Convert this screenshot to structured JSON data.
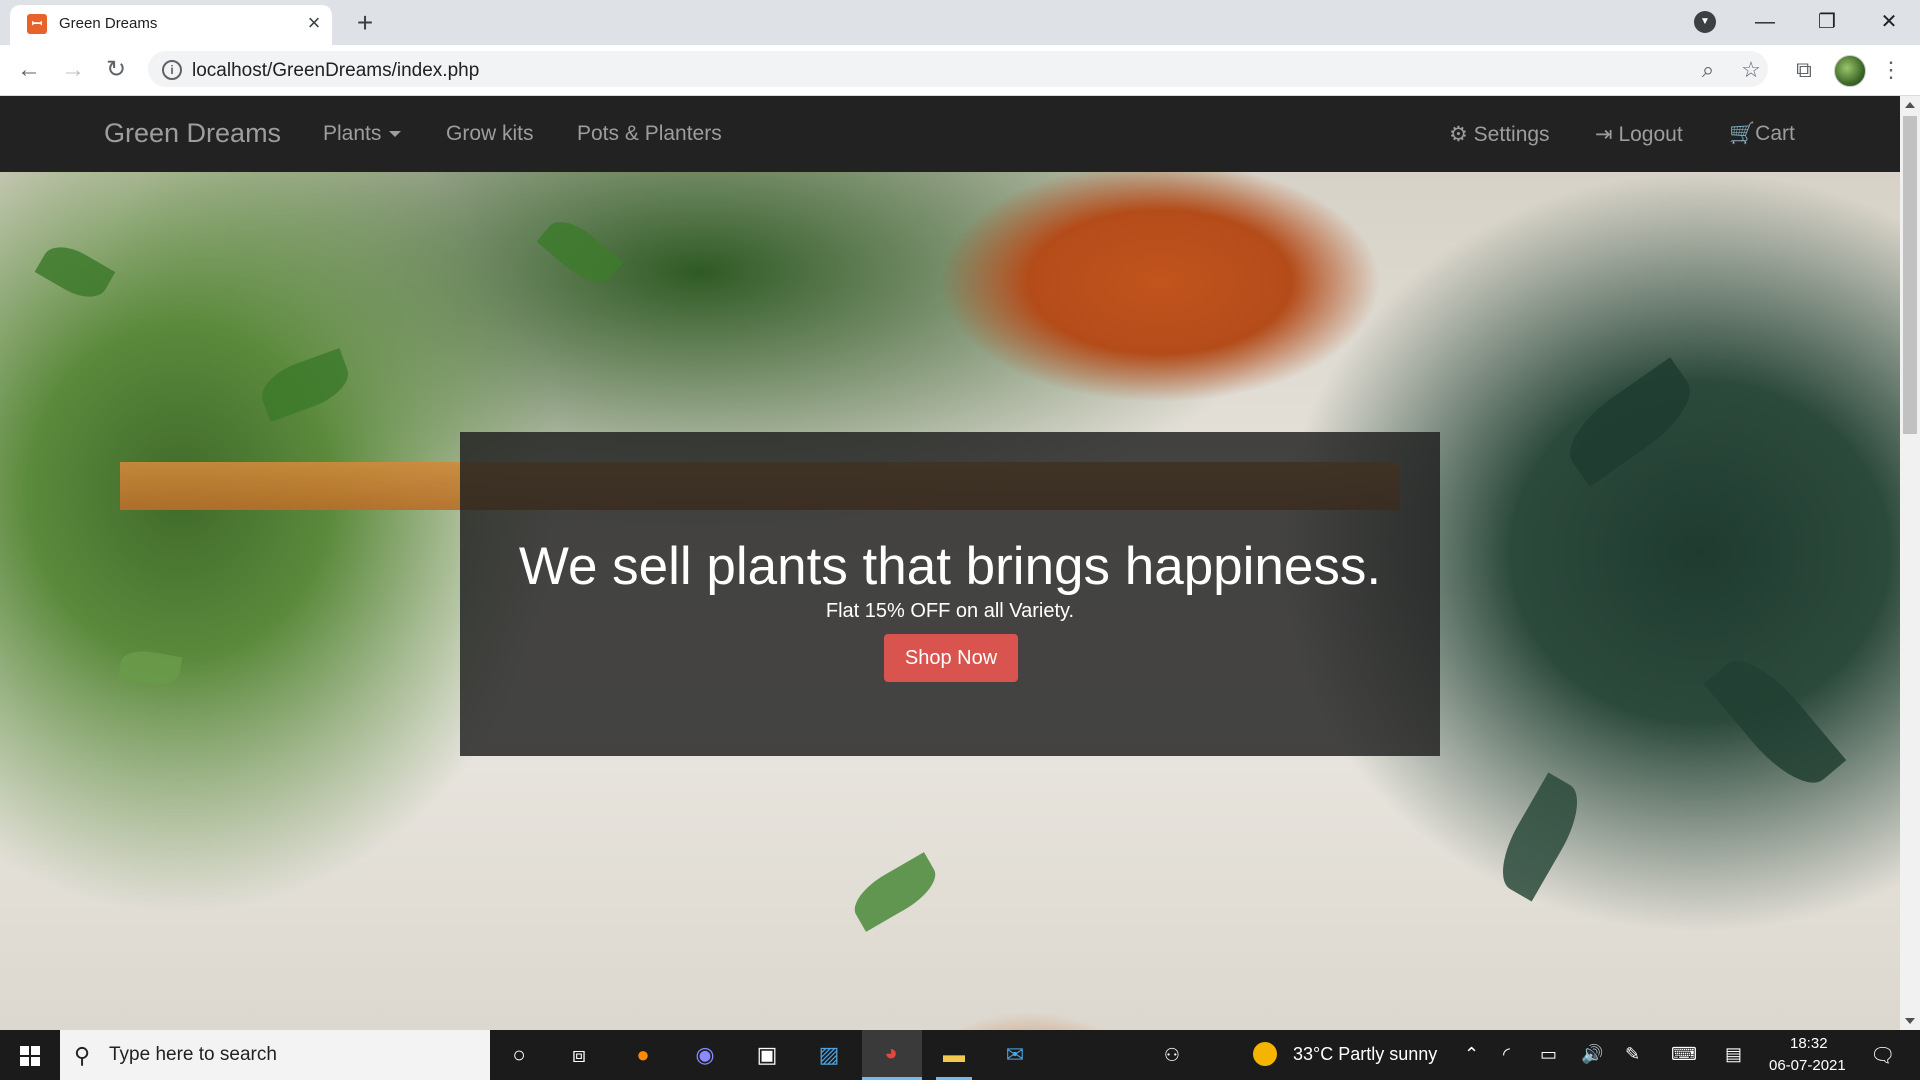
{
  "browser": {
    "tab_title": "Green Dreams",
    "tab_favicon": "xampp-icon",
    "url": "localhost/GreenDreams/index.php"
  },
  "site": {
    "brand": "Green Dreams",
    "nav_left": [
      "Plants",
      "Grow kits",
      "Pots & Planters"
    ],
    "nav_right": {
      "settings": "Settings",
      "logout": "Logout",
      "cart": "Cart"
    }
  },
  "hero": {
    "heading": "We sell plants that brings happiness.",
    "subheading": "Flat 15% OFF on all Variety.",
    "cta": "Shop Now",
    "cta_color": "#d9534f",
    "navbar_color": "#222222"
  },
  "taskbar": {
    "search_placeholder": "Type here to search",
    "weather": "33°C  Partly sunny",
    "time": "18:32",
    "date": "06-07-2021"
  }
}
